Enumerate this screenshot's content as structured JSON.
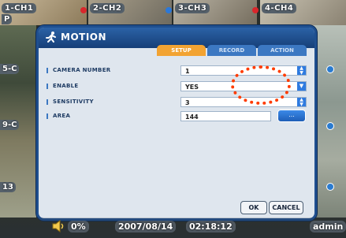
{
  "cameras": [
    {
      "label": "1-CH1",
      "dot_color": "#d9262b"
    },
    {
      "label": "2-CH2",
      "dot_color": "#2b78d9"
    },
    {
      "label": "3-CH3",
      "dot_color": "#d9262b"
    },
    {
      "label": "4-CH4",
      "dot_color": "#2b78d9"
    }
  ],
  "side_labels": {
    "left5": "5-C",
    "left9": "9-C",
    "left13": "13",
    "corner": "P"
  },
  "dialog": {
    "title": "MOTION",
    "tabs": [
      {
        "label": "SETUP",
        "active": true
      },
      {
        "label": "RECORD",
        "active": false
      },
      {
        "label": "ACTION",
        "active": false
      }
    ],
    "rows": [
      {
        "label": "CAMERA NUMBER",
        "value": "1",
        "control": "spinner"
      },
      {
        "label": "ENABLE",
        "value": "YES",
        "control": "dropdown"
      },
      {
        "label": "SENSITIVITY",
        "value": "3",
        "control": "spinner"
      },
      {
        "label": "AREA",
        "value": "144",
        "control": "button",
        "button_label": "..."
      }
    ],
    "ok_label": "OK",
    "cancel_label": "CANCEL"
  },
  "status": {
    "volume": "0%",
    "date": "2007/08/14",
    "time": "02:18:12",
    "user": "admin"
  },
  "colors": {
    "accent": "#2f7be0",
    "active_tab": "#f2a332",
    "highlight": "#ff3c00"
  }
}
